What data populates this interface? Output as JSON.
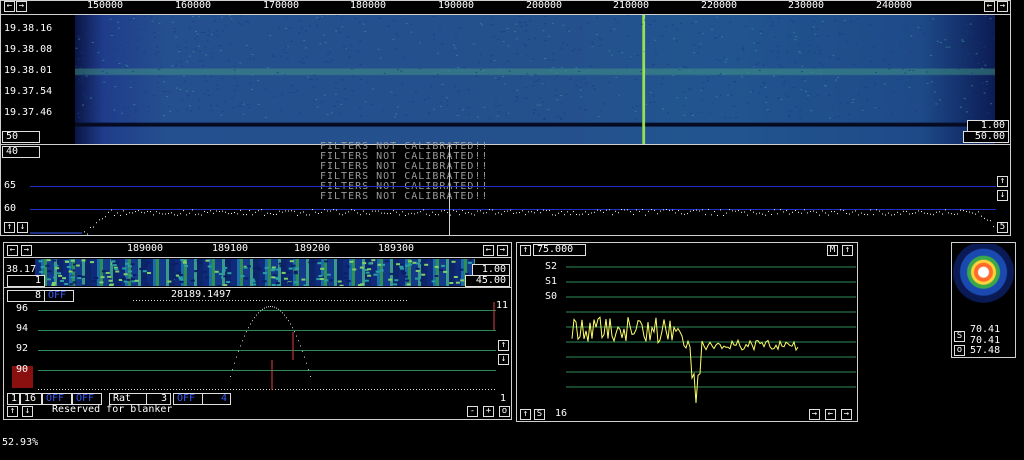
{
  "main": {
    "freq_ticks": [
      "150000",
      "160000",
      "170000",
      "180000",
      "190000",
      "200000",
      "210000",
      "220000",
      "230000",
      "240000"
    ],
    "times": [
      "19.38.16",
      "19.38.08",
      "19.38.01",
      "19.37.54",
      "19.37.46"
    ],
    "wf_left_val": "50",
    "wf_right_top": "1.00",
    "wf_right_bot": "50.00",
    "spec_left_val": "40",
    "spec_level_65": "65",
    "spec_level_60": "60",
    "warning_lines": [
      "FILTERS NOT CALIBRATED!!",
      "FILTERS NOT CALIBRATED!!",
      "FILTERS NOT CALIBRATED!!",
      "FILTERS NOT CALIBRATED!!",
      "FILTERS NOT CALIBRATED!!",
      "FILTERS NOT CALIBRATED!!"
    ],
    "spec_right_num": "5"
  },
  "baseband": {
    "freq_ticks": [
      "189000",
      "189100",
      "189200",
      "189300"
    ],
    "wf_left_val": "38.17",
    "wf_left_val2": "1",
    "wf_right_top": "1.00",
    "wf_right_bot": "45.00",
    "mode_num": "8",
    "mode_state": "OFF",
    "freq_readout": "28189.1497",
    "levels": [
      "96",
      "94",
      "92",
      "90"
    ],
    "right_top_num": "11",
    "bottom_nums": [
      "1",
      "16"
    ],
    "off1": "OFF",
    "off2": "OFF",
    "rat_label": "Rat",
    "rat_value": "3",
    "off3": "OFF",
    "off3_value": "4",
    "status_text": "Reserved for blanker",
    "right_bottom_num": "1",
    "minus_label": "-",
    "plus_label": "+",
    "o_label": "o"
  },
  "smeter": {
    "value": "75.000",
    "m_label": "M",
    "labels": [
      "S2",
      "S1",
      "S0"
    ],
    "s_label": "S",
    "bottom_num": "16"
  },
  "constellation": {
    "s_label": "S",
    "o_label": "o",
    "val1": "70.41",
    "val2": "70.41",
    "val3": "57.48"
  },
  "status_percent": "52.93%",
  "colors": {
    "accent_blue": "#3a5cff",
    "grid": "#2e8b57",
    "blue_line": "#2030c8",
    "trace": "#ffff66",
    "marker_red": "#e04040"
  },
  "icons": [
    "arrow-left-icon",
    "arrow-right-icon",
    "arrow-up-icon",
    "arrow-down-icon"
  ]
}
